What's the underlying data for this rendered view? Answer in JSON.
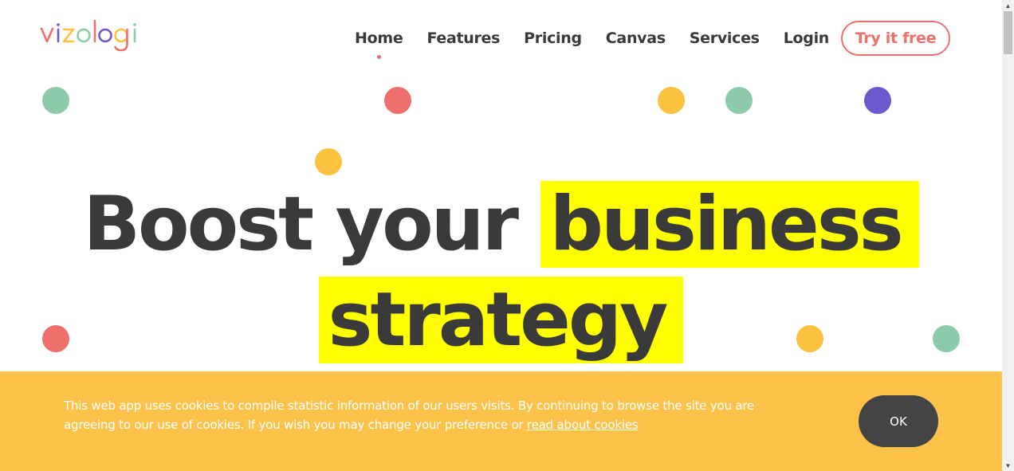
{
  "brand": {
    "logo_text": "vizologi",
    "colors": {
      "coral": "#ef6f6c",
      "green": "#8dcaaa",
      "yellow": "#fcc23f",
      "purple": "#6a5acd",
      "highlight": "#ffff00",
      "text": "#3a3a3a",
      "banner": "#fcc24a",
      "ok_button": "#444444"
    }
  },
  "nav": {
    "items": [
      {
        "label": "Home",
        "active": true
      },
      {
        "label": "Features"
      },
      {
        "label": "Pricing"
      },
      {
        "label": "Canvas"
      },
      {
        "label": "Services"
      },
      {
        "label": "Login"
      }
    ],
    "cta_label": "Try it free"
  },
  "hero": {
    "line1_plain": "Boost your",
    "line1_highlight": "business",
    "line2_highlight": "strategy"
  },
  "cookie": {
    "text": "This web app uses cookies to compile statistic information of our users visits. By continuing to browse the site you are agreeing to our use of cookies. If you wish you may change your preference or ",
    "link_text": "read about cookies",
    "ok_label": "OK"
  },
  "scrollbar": {
    "up_icon": "triangle-up",
    "down_icon": "triangle-down"
  }
}
